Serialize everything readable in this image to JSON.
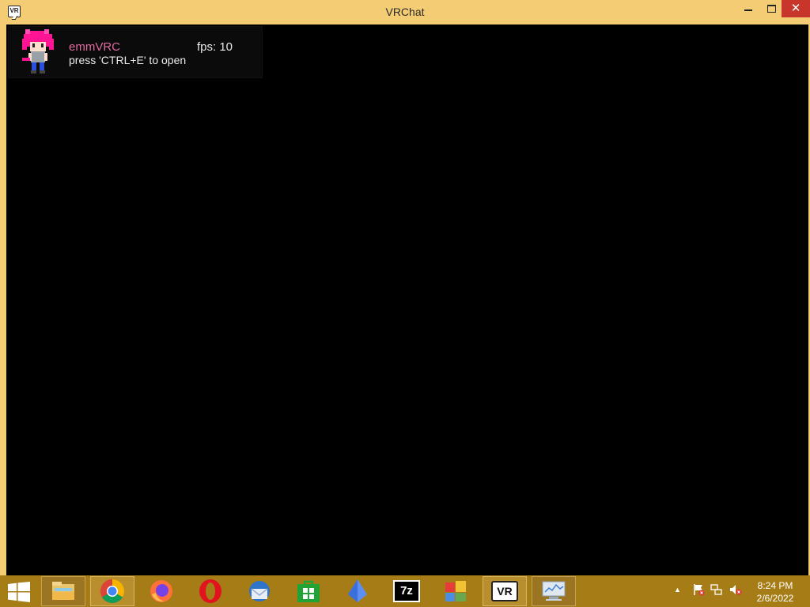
{
  "window": {
    "title": "VRChat",
    "app_icon_text": "VR",
    "controls": {
      "minimize_icon": "minimize-icon",
      "maximize_icon": "maximize-icon",
      "close_symbol": "✕"
    }
  },
  "overlay": {
    "name": "emmVRC",
    "fps": "fps: 10",
    "hint": "press 'CTRL+E' to open",
    "name_color": "#e06aa0"
  },
  "taskbar": {
    "apps": [
      {
        "name": "file-explorer-icon"
      },
      {
        "name": "chrome-icon"
      },
      {
        "name": "firefox-icon"
      },
      {
        "name": "opera-icon"
      },
      {
        "name": "thunderbird-icon"
      },
      {
        "name": "store-icon"
      },
      {
        "name": "vertex-app-icon"
      },
      {
        "name": "7zip-icon",
        "label": "7z"
      },
      {
        "name": "control-panel-icon"
      },
      {
        "name": "vrchat-icon",
        "label": "VR"
      },
      {
        "name": "resource-monitor-icon"
      }
    ],
    "tray": {
      "show_hidden_icons": "▲",
      "action_center_icon": "flag-icon",
      "network_icon": "network-icon",
      "volume_icon": "volume-muted-icon"
    },
    "clock": {
      "time": "8:24 PM",
      "date": "2/6/2022"
    },
    "accent_color": "#a67c16",
    "frame_color": "#f3cc73"
  }
}
